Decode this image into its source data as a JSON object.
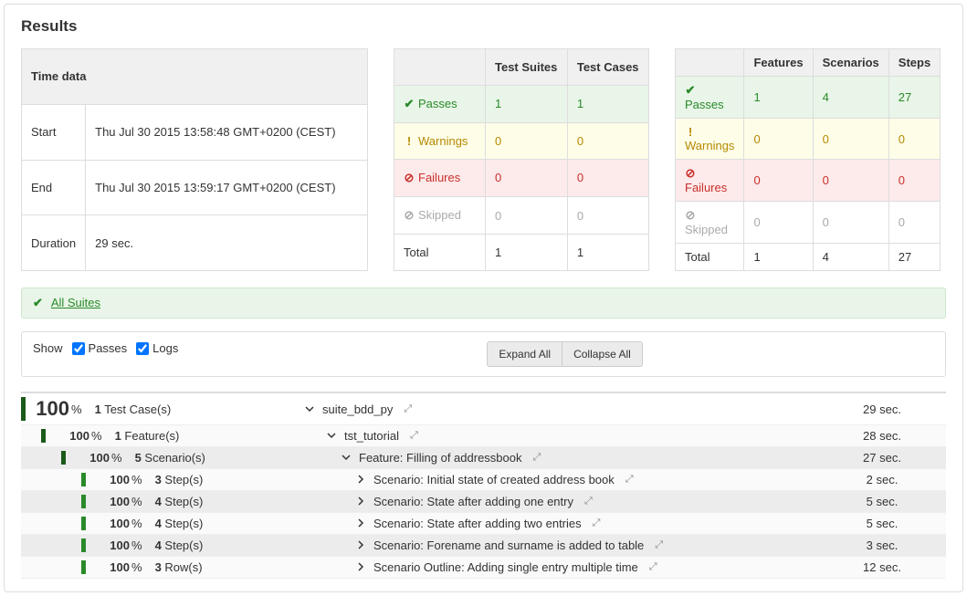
{
  "title": "Results",
  "time_data": {
    "header": "Time data",
    "start_label": "Start",
    "start_value": "Thu Jul 30 2015 13:58:48 GMT+0200 (CEST)",
    "end_label": "End",
    "end_value": "Thu Jul 30 2015 13:59:17 GMT+0200 (CEST)",
    "duration_label": "Duration",
    "duration_value": "29 sec."
  },
  "stats1": {
    "col1": "Test Suites",
    "col2": "Test Cases",
    "passes_label": "Passes",
    "passes_c1": "1",
    "passes_c2": "1",
    "warnings_label": "Warnings",
    "warnings_c1": "0",
    "warnings_c2": "0",
    "failures_label": "Failures",
    "failures_c1": "0",
    "failures_c2": "0",
    "skipped_label": "Skipped",
    "skipped_c1": "0",
    "skipped_c2": "0",
    "total_label": "Total",
    "total_c1": "1",
    "total_c2": "1"
  },
  "stats2": {
    "col1": "Features",
    "col2": "Scenarios",
    "col3": "Steps",
    "passes_label": "Passes",
    "passes_c1": "1",
    "passes_c2": "4",
    "passes_c3": "27",
    "warnings_label": "Warnings",
    "warnings_c1": "0",
    "warnings_c2": "0",
    "warnings_c3": "0",
    "failures_label": "Failures",
    "failures_c1": "0",
    "failures_c2": "0",
    "failures_c3": "0",
    "skipped_label": "Skipped",
    "skipped_c1": "0",
    "skipped_c2": "0",
    "skipped_c3": "0",
    "total_label": "Total",
    "total_c1": "1",
    "total_c2": "4",
    "total_c3": "27"
  },
  "all_suites": "All Suites",
  "controls": {
    "show_label": "Show",
    "passes_label": "Passes",
    "logs_label": "Logs",
    "expand_all": "Expand All",
    "collapse_all": "Collapse All"
  },
  "tree": {
    "r0": {
      "pct": "100",
      "unit": "%",
      "count": "1",
      "count_label": "Test Case(s)",
      "name": "suite_bdd_py",
      "time": "29 sec."
    },
    "r1": {
      "pct": "100",
      "unit": "%",
      "count": "1",
      "count_label": "Feature(s)",
      "name": "tst_tutorial",
      "time": "28 sec."
    },
    "r2": {
      "pct": "100",
      "unit": "%",
      "count": "5",
      "count_label": "Scenario(s)",
      "name": "Feature: Filling of addressbook",
      "time": "27 sec."
    },
    "r3": {
      "pct": "100",
      "unit": "%",
      "count": "3",
      "count_label": "Step(s)",
      "name": "Scenario: Initial state of created address book",
      "time": "2 sec."
    },
    "r4": {
      "pct": "100",
      "unit": "%",
      "count": "4",
      "count_label": "Step(s)",
      "name": "Scenario: State after adding one entry",
      "time": "5 sec."
    },
    "r5": {
      "pct": "100",
      "unit": "%",
      "count": "4",
      "count_label": "Step(s)",
      "name": "Scenario: State after adding two entries",
      "time": "5 sec."
    },
    "r6": {
      "pct": "100",
      "unit": "%",
      "count": "4",
      "count_label": "Step(s)",
      "name": "Scenario: Forename and surname is added to table",
      "time": "3 sec."
    },
    "r7": {
      "pct": "100",
      "unit": "%",
      "count": "3",
      "count_label": "Row(s)",
      "name": "Scenario Outline: Adding single entry multiple time",
      "time": "12 sec."
    }
  }
}
